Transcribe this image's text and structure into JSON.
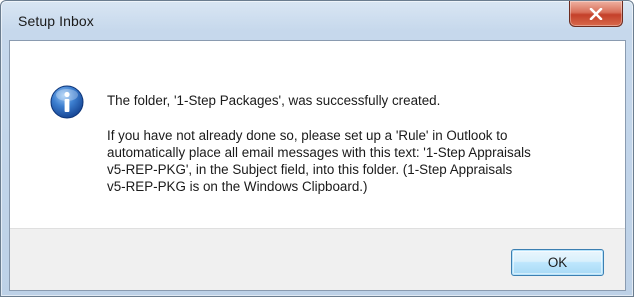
{
  "window": {
    "title": "Setup Inbox"
  },
  "message": {
    "main": "The folder, '1-Step Packages', was successfully created.",
    "detail_lines": [
      "If you have not already done so, please set up a 'Rule' in Outlook to",
      "automatically place all email messages with this text: '1-Step Appraisals",
      "v5-REP-PKG', in the Subject field, into this folder. (1-Step Appraisals",
      "v5-REP-PKG is on the Windows Clipboard.)"
    ]
  },
  "buttons": {
    "ok_label": "OK"
  },
  "icons": {
    "close": "close-icon",
    "info": "information-icon"
  },
  "colors": {
    "close_button": "#c4402a",
    "info_icon": "#1f5fb4",
    "ok_button_border": "#3c7fb1",
    "footer": "#f0f0f0"
  }
}
